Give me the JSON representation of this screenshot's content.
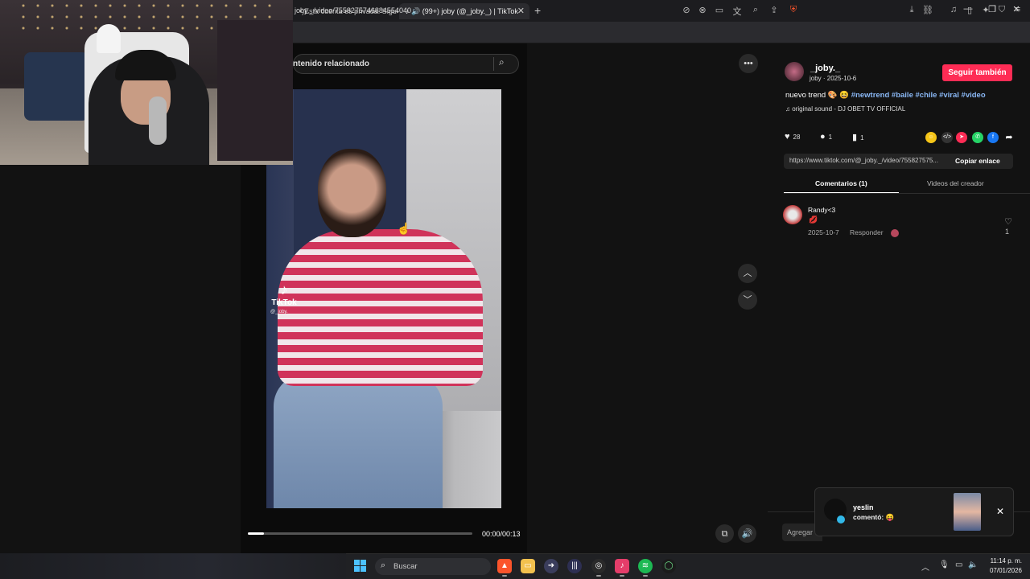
{
  "browser": {
    "tabs": [
      {
        "label": "•)Esta cuenta es privada. Sigue e"
      },
      {
        "label": "(99+) joby (@_joby._) | TikTok"
      }
    ],
    "new_tab_icon": "plus-icon",
    "url": "joby._/video/7558275746884554040",
    "window_controls": [
      "minimize",
      "restore",
      "close"
    ]
  },
  "search": {
    "placeholder": "ntenido relacionado"
  },
  "video": {
    "watermark_brand": "TikTok",
    "watermark_user": "@_joby._",
    "time": "00:00/00:13",
    "progress": 0.07
  },
  "creator": {
    "name": "_joby._",
    "meta": "joby · 2025-10-6",
    "follow_label": "Seguir también",
    "caption_text": "nuevo trend 🎨 😆",
    "hashtags": [
      "#newtrend",
      "#baile",
      "#chile",
      "#viral",
      "#video"
    ],
    "music": "original sound - DJ OBET TV OFFICIAL"
  },
  "actions": {
    "likes": "28",
    "comments": "1",
    "saves": "1"
  },
  "share": {
    "link": "https://www.tiktok.com/@_joby._/video/755827575...",
    "copy_label": "Copiar enlace",
    "colors": {
      "gold": "#f5c518",
      "red": "#fe2c55",
      "whatsapp": "#25d366",
      "facebook": "#1877f2"
    }
  },
  "tabs": {
    "comments": "Comentarios (1)",
    "creator_videos": "Videos del creador"
  },
  "comment": {
    "user": "Randy<3",
    "text": "💋",
    "date": "2025-10-7",
    "reply": "Responder",
    "likes": "1"
  },
  "add_comment": {
    "placeholder": "Agregar"
  },
  "notification": {
    "user": "yeslin",
    "message": "comentó: 😝"
  },
  "taskbar": {
    "search_label": "Buscar",
    "time": "11:14 p. m.",
    "date": "07/01/2026"
  },
  "theme": {
    "accent": "#fe2c55",
    "hashtag": "#8ab8f5",
    "background": "#121212"
  }
}
